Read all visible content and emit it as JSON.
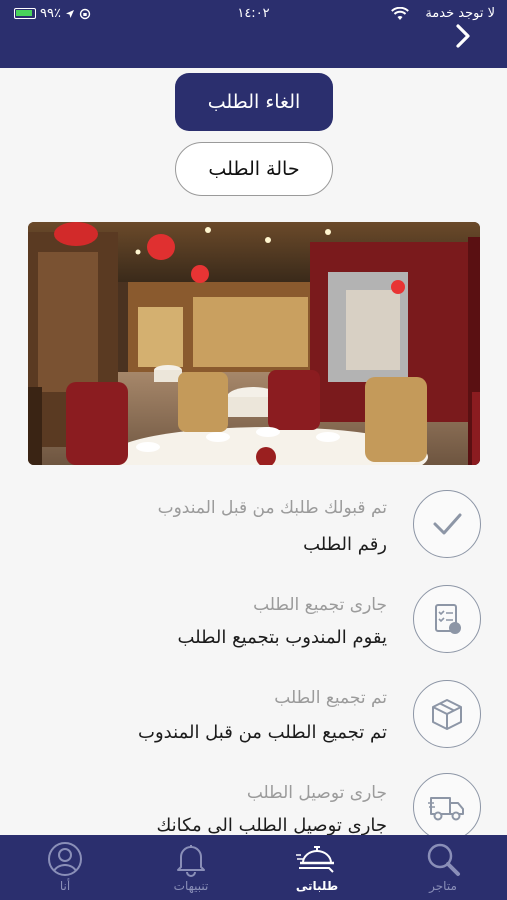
{
  "status_bar": {
    "carrier": "لا توجد خدمة",
    "time": "١٤:٠٢",
    "battery": "٩٩٪"
  },
  "actions": {
    "cancel_label": "الغاء الطلب",
    "status_label": "حالة الطلب"
  },
  "steps": [
    {
      "title": "تم قبولك طلبك من قبل المندوب",
      "subtitle": "رقم الطلب",
      "icon": "check-icon"
    },
    {
      "title": "جارى تجميع الطلب",
      "subtitle": "يقوم المندوب بتجميع الطلب",
      "icon": "checklist-icon"
    },
    {
      "title": "تم تجميع الطلب",
      "subtitle": "تم تجميع الطلب من قبل المندوب",
      "icon": "box-icon"
    },
    {
      "title": "جارى توصيل الطلب",
      "subtitle": "جارى توصيل الطلب الى مكانك",
      "icon": "delivery-truck-icon"
    }
  ],
  "tabs": [
    {
      "label": "متاجر",
      "icon": "search-icon"
    },
    {
      "label": "طلباتى",
      "icon": "food-delivery-icon"
    },
    {
      "label": "تنبيهات",
      "icon": "bell-icon"
    },
    {
      "label": "أنا",
      "icon": "user-icon"
    }
  ],
  "colors": {
    "brand": "#2b2f6e",
    "muted": "#9b9b9b",
    "icon_outline": "#8d96a6"
  }
}
